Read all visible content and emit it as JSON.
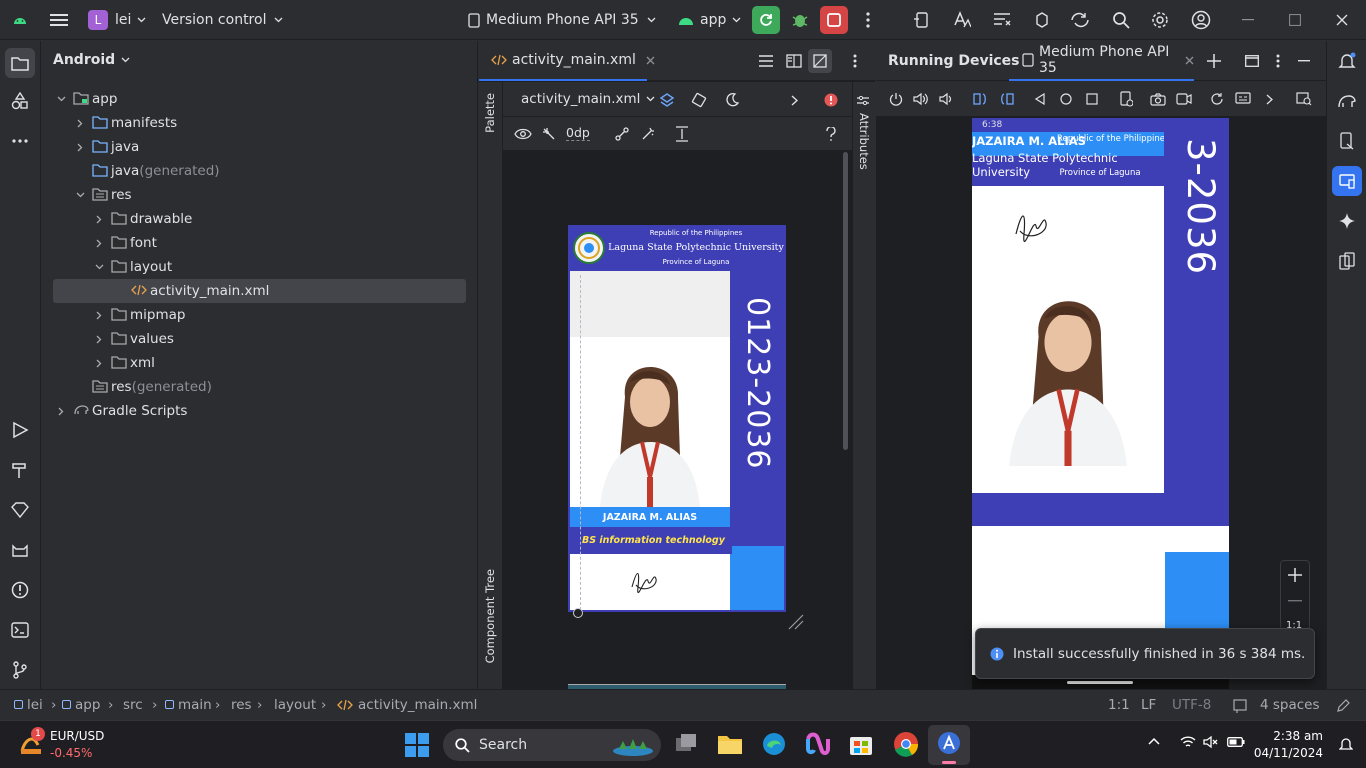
{
  "titlebar": {
    "project_initial": "L",
    "project_name": "lei",
    "vcs": "Version control",
    "device": "Medium Phone API 35",
    "run_config": "app"
  },
  "project_panel": {
    "view_mode": "Android",
    "tree": [
      {
        "label": "app",
        "suffix": ""
      },
      {
        "label": "manifests",
        "suffix": ""
      },
      {
        "label": "java",
        "suffix": ""
      },
      {
        "label": "java",
        "suffix": " (generated)"
      },
      {
        "label": "res",
        "suffix": ""
      },
      {
        "label": "drawable",
        "suffix": ""
      },
      {
        "label": "font",
        "suffix": ""
      },
      {
        "label": "layout",
        "suffix": ""
      },
      {
        "label": "activity_main.xml",
        "suffix": ""
      },
      {
        "label": "mipmap",
        "suffix": ""
      },
      {
        "label": "values",
        "suffix": ""
      },
      {
        "label": "xml",
        "suffix": ""
      },
      {
        "label": "res",
        "suffix": " (generated)"
      },
      {
        "label": "Gradle Scripts",
        "suffix": ""
      }
    ]
  },
  "editor": {
    "tab_label": "activity_main.xml",
    "file_dropdown": "activity_main.xml",
    "margin_value": "0dp",
    "palette_label": "Palette",
    "component_tree_label": "Component Tree",
    "attributes_label": "Attributes",
    "preview": {
      "republic": "Republic of the Philippines",
      "university": "Laguna State Polytechnic University",
      "province": "Province of Laguna",
      "name": "JAZAIRA M. ALIAS",
      "course": "BS information technology",
      "id_number": "0123-2036"
    }
  },
  "running_devices": {
    "title": "Running Devices",
    "device_tab": "Medium Phone API 35",
    "clock": "6:38",
    "name_overlay": "JAZAIRA M. ALIAS",
    "republic": "Republic of the Philippines",
    "university": "Laguna State Polytechnic University",
    "province": "Province of Laguna",
    "id_fragment": "3-2036",
    "zoom_label": "1:1",
    "notification": "Install successfully finished in 36 s 384 ms."
  },
  "statusbar": {
    "breadcrumbs": [
      "lei",
      "app",
      "src",
      "main",
      "res",
      "layout",
      "activity_main.xml"
    ],
    "position": "1:1",
    "line_sep": "LF",
    "encoding": "UTF-8",
    "indent": "4 spaces"
  },
  "taskbar": {
    "ticker_name": "EUR/USD",
    "ticker_change": "-0.45%",
    "ticker_badge": "1",
    "search_label": "Search",
    "time": "2:38 am",
    "date": "04/11/2024"
  },
  "colors": {
    "accent": "#3574f0",
    "card_purple": "#3f3fb5",
    "card_blue": "#2d8ef5",
    "course_yellow": "#ffe54a",
    "run_green": "#3fa95b",
    "stop_red": "#d64545"
  }
}
